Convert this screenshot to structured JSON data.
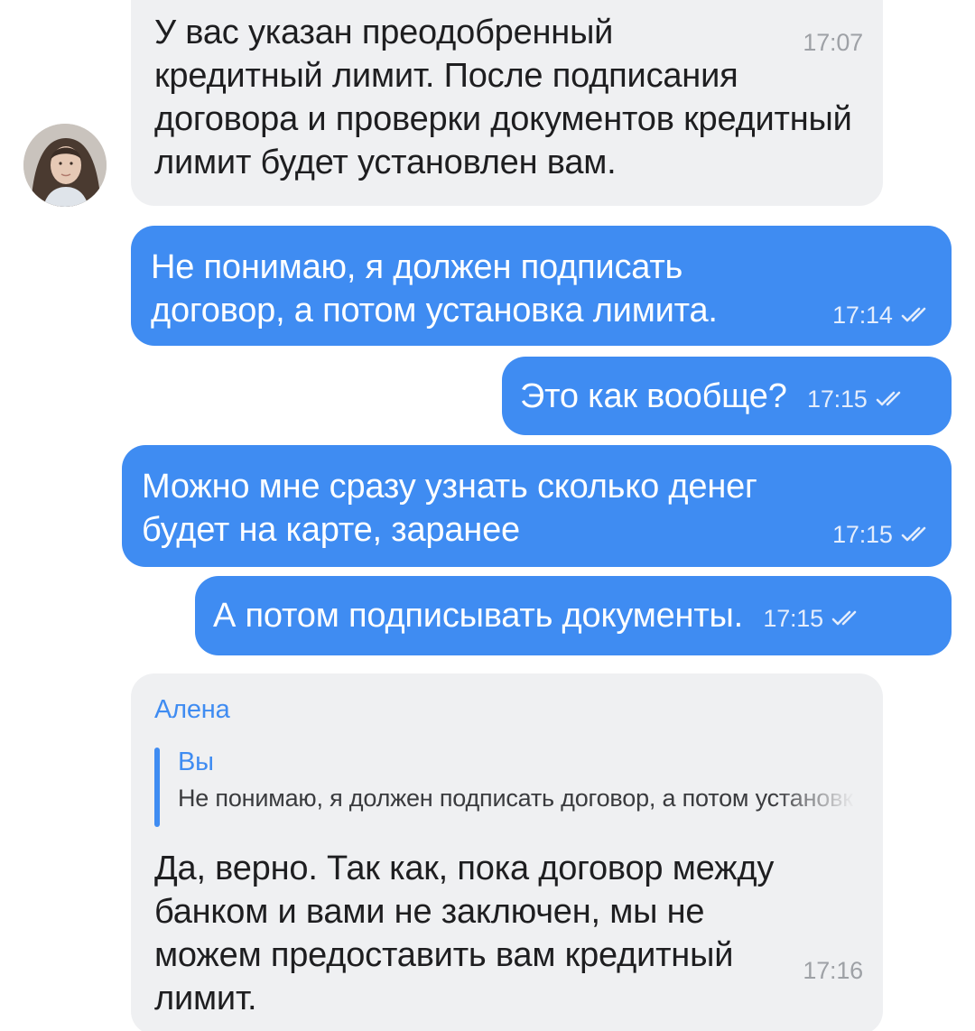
{
  "messages": [
    {
      "text": "У вас указан преодобренный кредитный лимит. После подписания договора и проверки документов кредитный лимит будет установлен вам.",
      "time": "17:07"
    },
    {
      "text": "Не понимаю, я должен подписать договор, а потом установка лимита.",
      "time": "17:14"
    },
    {
      "text": "Это как вообще?",
      "time": "17:15"
    },
    {
      "text": "Можно мне сразу узнать сколько денег будет на карте, заранее",
      "time": "17:15"
    },
    {
      "text": "А потом подписывать документы.",
      "time": "17:15"
    },
    {
      "sender": "Алена",
      "reply_to": {
        "author": "Вы",
        "text": "Не понимаю, я должен подписать договор, а потом установка лимита."
      },
      "text": "Да, верно. Так как, пока договор между банком и вами не заключен, мы не можем предоставить вам кредитный лимит.",
      "time": "17:16"
    }
  ],
  "icons": {
    "read_status": "double-check-icon",
    "avatar": "avatar"
  },
  "colors": {
    "outgoing_bubble": "#3f8cf2",
    "incoming_bubble": "#eff0f2",
    "accent": "#3f8cf2",
    "background": "#ffffff"
  }
}
